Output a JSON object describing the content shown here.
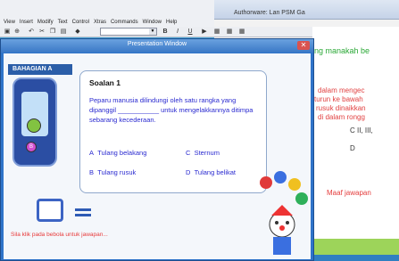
{
  "background_window": {
    "title": "Authorware: Lan PSM Ga",
    "heading": "ng manakah be",
    "lines": [
      "dalam mengec",
      "turun ke bawah",
      "rusuk dinaikkan",
      "di dalam rongg"
    ],
    "option_c": "C   II, III,",
    "option_d": "D",
    "sorry_text": "Maaf jawapan"
  },
  "app": {
    "menu": [
      "View",
      "Insert",
      "Modify",
      "Text",
      "Control",
      "Xtras",
      "Commands",
      "Window",
      "Help"
    ],
    "toolbar": {
      "bold": "B",
      "italic": "I",
      "underline": "U"
    }
  },
  "presentation": {
    "title": "Presentation Window",
    "section_label": "BAHAGIAN A",
    "phone_dot_label": "B",
    "question_number": "Soalan 1",
    "question": "Peparu manusia dilindungi oleh satu rangka yang dipanggil ___________ untuk mengelakkannya ditimpa sebarang kecederaan.",
    "options": [
      {
        "letter": "A",
        "text": "Tulang belakang"
      },
      {
        "letter": "C",
        "text": "Sternum"
      },
      {
        "letter": "B",
        "text": "Tulang rusuk"
      },
      {
        "letter": "D",
        "text": "Tulang belikat"
      }
    ],
    "hint": "Sila klik pada bebola untuk jawapan..."
  }
}
